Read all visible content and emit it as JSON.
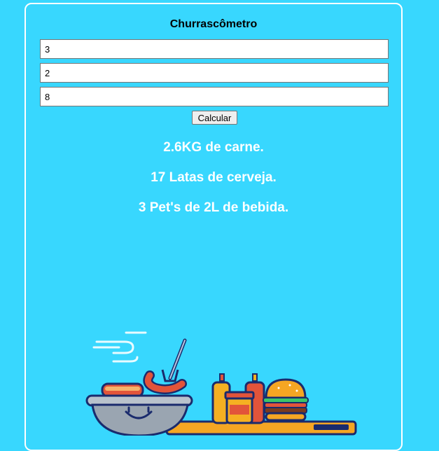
{
  "form": {
    "title": "Churrascômetro",
    "field_1_value": "3",
    "field_2_value": "2",
    "field_3_value": "8",
    "button_label": "Calcular"
  },
  "results": {
    "meat": "2.6KG de carne.",
    "beer": "17 Latas de cerveja.",
    "drinks": "3 Pet's de 2L de bebida."
  },
  "colors": {
    "background": "#38d7fe",
    "result_text": "#ffffff",
    "card_border": "#ffffff"
  },
  "illustration": {
    "icons": [
      "grill-bowl-icon",
      "sausage-on-fork-icon",
      "ketchup-bottle-icon",
      "mustard-bottle-icon",
      "jar-icon",
      "burger-icon",
      "cutting-board-icon",
      "smoke-icon"
    ]
  }
}
